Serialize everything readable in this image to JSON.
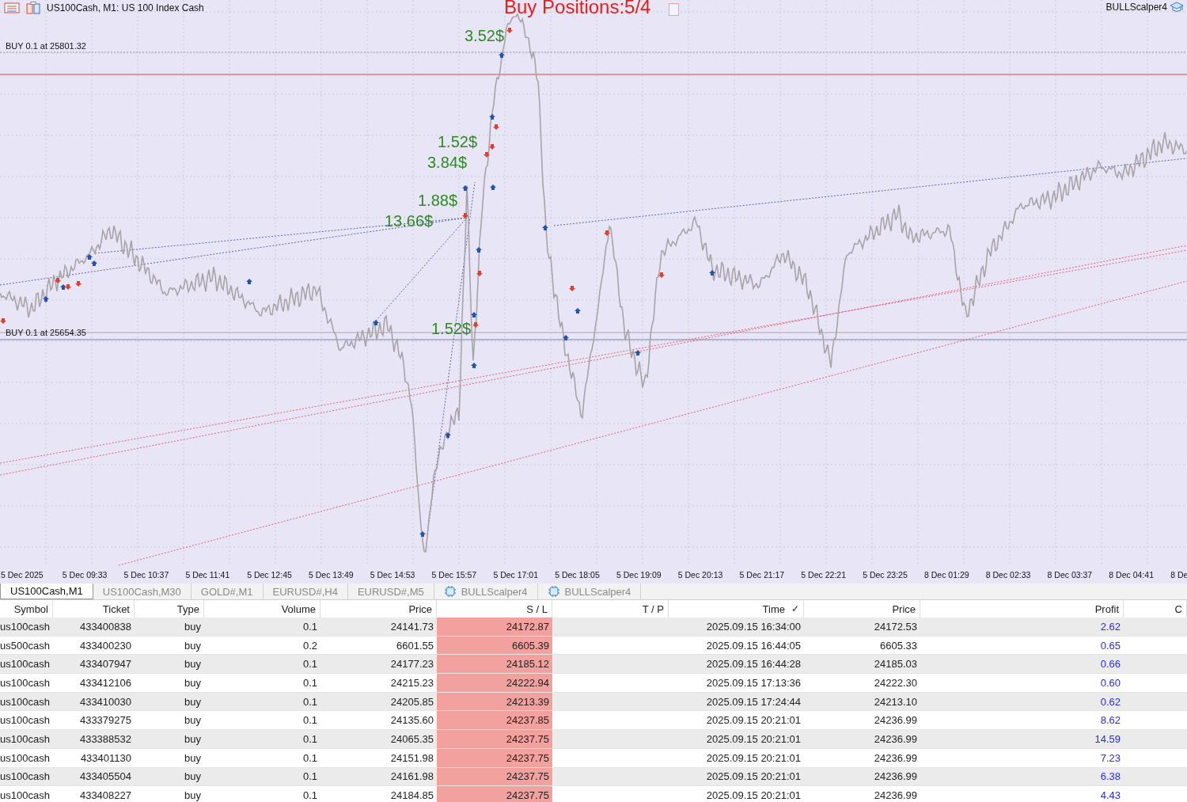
{
  "chart": {
    "symbol_title": "US100Cash, M1:  US 100 Index Cash",
    "headline": "Buy Positions:5/4",
    "expert": "BULLScalper4",
    "levels": [
      {
        "label": "BUY 0.1 at 25801.32"
      },
      {
        "label": "BUY 0.1 at 25654.35"
      }
    ],
    "profit_labels": [
      "3.52$",
      "1.52$",
      "3.84$",
      "1.88$",
      "13.66$",
      "1.52$"
    ],
    "time_axis": [
      "5 Dec 2025",
      "5 Dec 09:33",
      "5 Dec 10:37",
      "5 Dec 11:41",
      "5 Dec 12:45",
      "5 Dec 13:49",
      "5 Dec 14:53",
      "5 Dec 15:57",
      "5 Dec 17:01",
      "5 Dec 18:05",
      "5 Dec 19:09",
      "5 Dec 20:13",
      "5 Dec 21:17",
      "5 Dec 22:21",
      "5 Dec 23:25",
      "8 Dec 01:29",
      "8 Dec 02:33",
      "8 Dec 03:37",
      "8 Dec 04:41",
      "8 De"
    ]
  },
  "tabs": [
    {
      "label": "US100Cash,M1",
      "selected": true,
      "kind": "chart"
    },
    {
      "label": "US100Cash,M30",
      "selected": false,
      "kind": "chart"
    },
    {
      "label": "GOLD#,M1",
      "selected": false,
      "kind": "chart"
    },
    {
      "label": "EURUSD#,H4",
      "selected": false,
      "kind": "chart"
    },
    {
      "label": "EURUSD#,M5",
      "selected": false,
      "kind": "chart"
    },
    {
      "label": "BULLScalper4",
      "selected": false,
      "kind": "expert"
    },
    {
      "label": "BULLScalper4",
      "selected": false,
      "kind": "expert"
    }
  ],
  "table": {
    "columns": [
      {
        "label": "Symbol"
      },
      {
        "label": "Ticket"
      },
      {
        "label": "Type"
      },
      {
        "label": "Volume"
      },
      {
        "label": "Price"
      },
      {
        "label": "S / L"
      },
      {
        "label": "T / P"
      },
      {
        "label": "Time",
        "sort_mark": "✓"
      },
      {
        "label": "Price"
      },
      {
        "label": "Profit"
      },
      {
        "label": "C"
      }
    ],
    "rows": [
      [
        "us100cash",
        "433400838",
        "buy",
        "0.1",
        "24141.73",
        "24172.87",
        "",
        "2025.09.15 16:34:00",
        "24172.53",
        "2.62"
      ],
      [
        "us500cash",
        "433400230",
        "buy",
        "0.2",
        "6601.55",
        "6605.39",
        "",
        "2025.09.15 16:44:05",
        "6605.33",
        "0.65"
      ],
      [
        "us100cash",
        "433407947",
        "buy",
        "0.1",
        "24177.23",
        "24185.12",
        "",
        "2025.09.15 16:44:28",
        "24185.03",
        "0.66"
      ],
      [
        "us100cash",
        "433412106",
        "buy",
        "0.1",
        "24215.23",
        "24222.94",
        "",
        "2025.09.15 17:13:36",
        "24222.30",
        "0.60"
      ],
      [
        "us100cash",
        "433410030",
        "buy",
        "0.1",
        "24205.85",
        "24213.39",
        "",
        "2025.09.15 17:24:44",
        "24213.10",
        "0.62"
      ],
      [
        "us100cash",
        "433379275",
        "buy",
        "0.1",
        "24135.60",
        "24237.85",
        "",
        "2025.09.15 20:21:01",
        "24236.99",
        "8.62"
      ],
      [
        "us100cash",
        "433388532",
        "buy",
        "0.1",
        "24065.35",
        "24237.75",
        "",
        "2025.09.15 20:21:01",
        "24236.99",
        "14.59"
      ],
      [
        "us100cash",
        "433401130",
        "buy",
        "0.1",
        "24151.98",
        "24237.75",
        "",
        "2025.09.15 20:21:01",
        "24236.99",
        "7.23"
      ],
      [
        "us100cash",
        "433405504",
        "buy",
        "0.1",
        "24161.98",
        "24237.75",
        "",
        "2025.09.15 20:21:01",
        "24236.99",
        "6.38"
      ],
      [
        "us100cash",
        "433408227",
        "buy",
        "0.1",
        "24184.85",
        "24237.75",
        "",
        "2025.09.15 20:21:01",
        "24236.99",
        "4.43"
      ]
    ]
  }
}
